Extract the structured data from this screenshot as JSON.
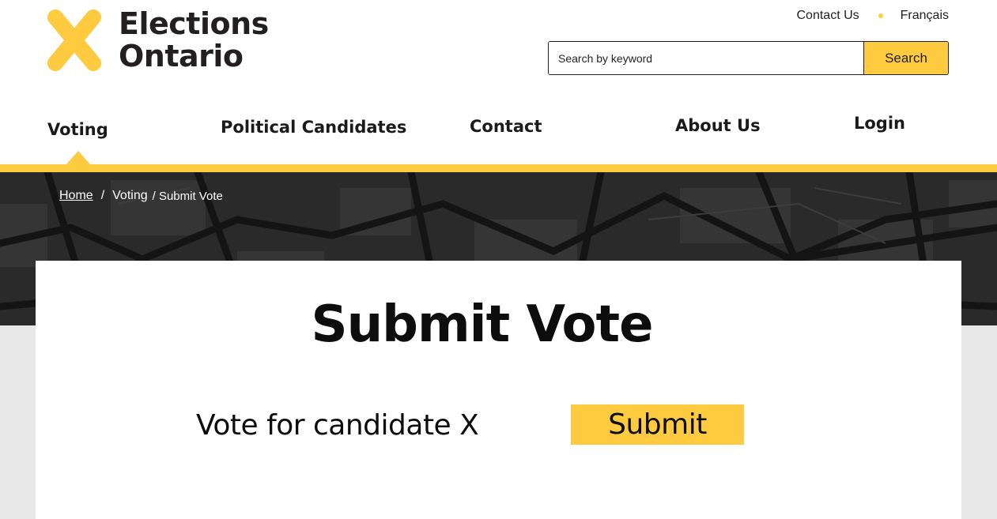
{
  "brand": {
    "name_line1": "Elections",
    "name_line2": "Ontario",
    "logo_icon": "x-logo-icon",
    "accent_color": "#fdca40",
    "text_color": "#231f20"
  },
  "utility": {
    "contact_label": "Contact Us",
    "language_label": "Français"
  },
  "search": {
    "placeholder": "Search by keyword",
    "value": "",
    "button_label": "Search"
  },
  "nav": {
    "items": [
      {
        "label": "Voting",
        "active": true
      },
      {
        "label": "Political Candidates",
        "active": false
      },
      {
        "label": "Contact",
        "active": false
      },
      {
        "label": "About Us",
        "active": false
      },
      {
        "label": "Login",
        "active": false
      }
    ]
  },
  "breadcrumb": {
    "home": "Home",
    "separator": "/",
    "voting": "Voting",
    "current": "/ Submit Vote"
  },
  "main": {
    "title": "Submit Vote",
    "vote_label": "Vote for candidate X",
    "submit_label": "Submit"
  }
}
